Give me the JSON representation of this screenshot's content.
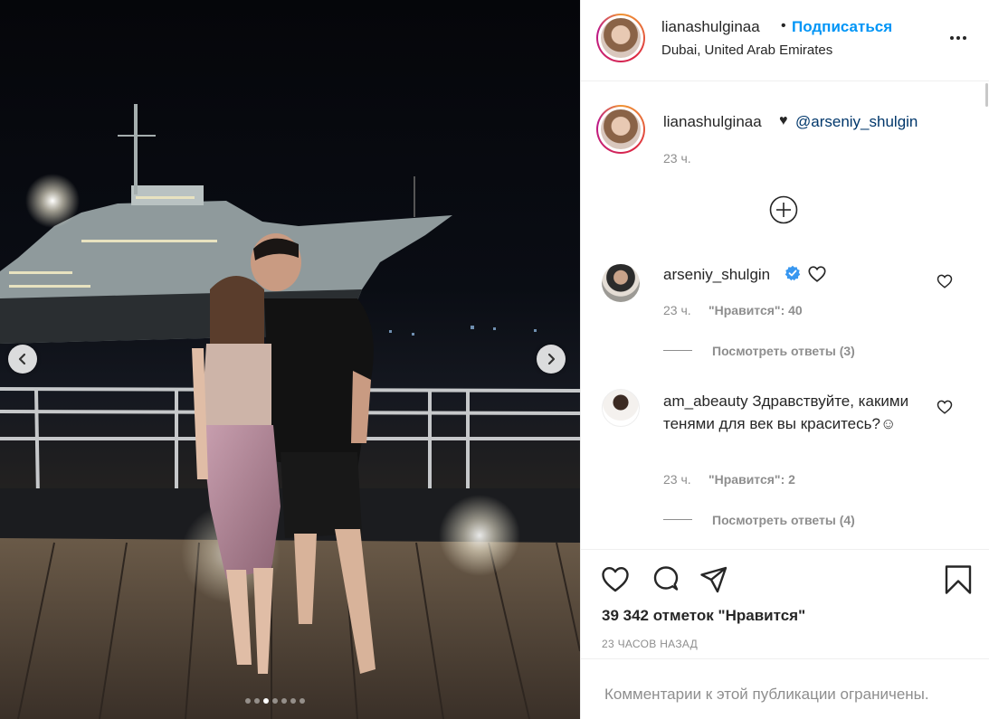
{
  "post": {
    "username": "lianashulginaa",
    "follow_label": "Подписаться",
    "separator": "•",
    "location": "Dubai, United Arab Emirates"
  },
  "caption": {
    "username": "lianashulginaa",
    "heart": "♥",
    "mention": "@arseniy_shulgin",
    "time": "23 ч."
  },
  "comments": [
    {
      "username": "arseniy_shulgin",
      "verified": true,
      "text": "",
      "time": "23 ч.",
      "likes": "\"Нравится\": 40",
      "replies": "Посмотреть ответы (3)"
    },
    {
      "username": "am_abeauty",
      "verified": false,
      "text": "Здравствуйте, какими тенями для век вы краситесь?☺",
      "time": "23 ч.",
      "likes": "\"Нравится\": 2",
      "replies": "Посмотреть ответы (4)"
    }
  ],
  "stats": {
    "likes": "39 342 отметок \"Нравится\"",
    "posted": "23 ЧАСОВ НАЗАД"
  },
  "footer": {
    "comments_closed": "Комментарии к этой публикации ограничены."
  },
  "carousel": {
    "total": 7,
    "active_index": 2
  },
  "colors": {
    "follow": "#0095f6",
    "mention": "#00376b",
    "secondary": "#8e8e8e",
    "verified": "#3897f0"
  }
}
